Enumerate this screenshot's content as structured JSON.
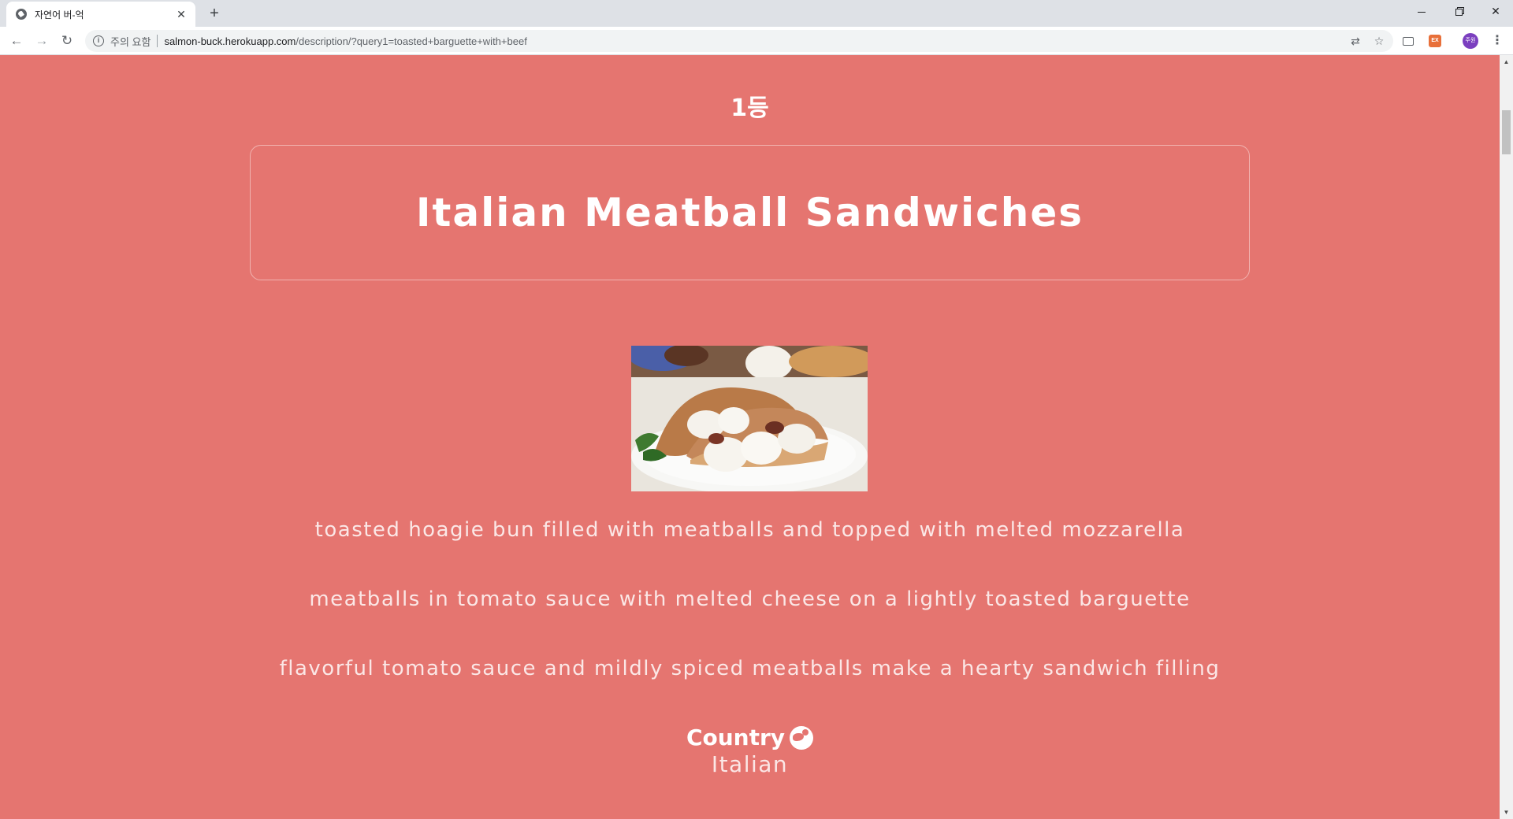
{
  "browser": {
    "tab_title": "자연어 버-억",
    "new_tab_label": "+",
    "security_label": "주의 요함",
    "url_host": "salmon-buck.herokuapp.com",
    "url_path": "/description/?query1=toasted+barguette+with+beef",
    "profile_initials": "주원",
    "extension_label": "EX"
  },
  "page": {
    "rank": "1등",
    "title": "Italian Meatball Sandwiches",
    "descriptions": [
      "toasted hoagie bun filled with meatballs and topped with melted mozzarella",
      "meatballs in tomato sauce with melted cheese on a lightly toasted barguette",
      "flavorful tomato sauce and mildly spiced meatballs make a hearty sandwich filling"
    ],
    "country_label": "Country",
    "country_value": "Italian"
  },
  "colors": {
    "page_background": "#e57570",
    "text": "#ffffff",
    "chrome_tabstrip": "#dee1e6"
  },
  "icons": {
    "page_favicon": "globe-icon",
    "country": "globe-icon"
  }
}
